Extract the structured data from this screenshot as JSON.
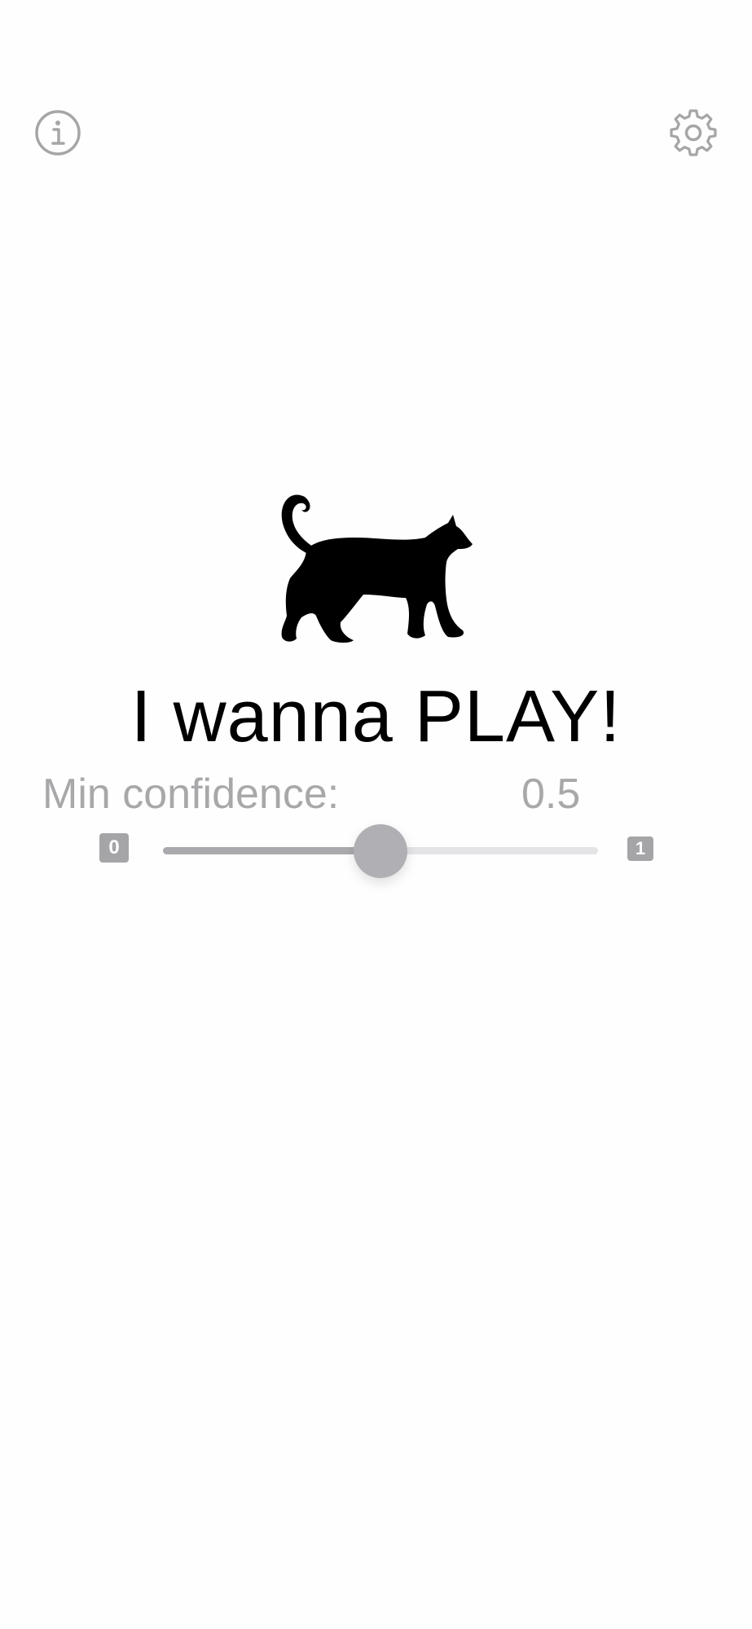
{
  "header": {
    "info_icon": "info-circle-icon",
    "settings_icon": "gear-icon"
  },
  "main": {
    "illustration": "walking-cat-icon",
    "title": "I wanna PLAY!"
  },
  "confidence": {
    "label": "Min confidence:",
    "value_text": "0.5",
    "value": 0.5,
    "min_label": "0",
    "max_label": "1"
  },
  "colors": {
    "icon_gray": "#a6a6a8",
    "text_gray": "#a8a8aa",
    "track": "#e4e4e6",
    "track_fill": "#aaaaae",
    "thumb": "#b0b0b4"
  }
}
